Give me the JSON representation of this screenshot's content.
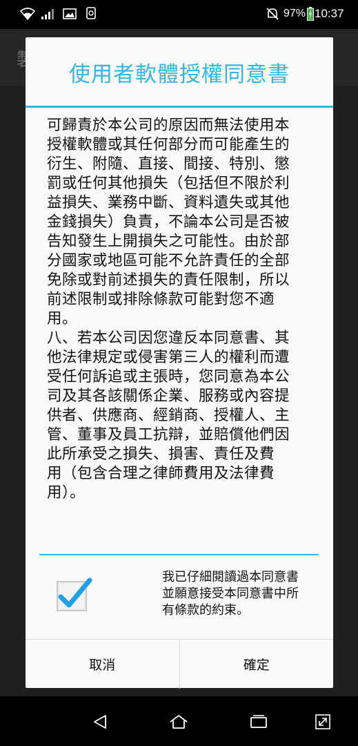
{
  "status_bar": {
    "battery_percent": "97%",
    "time": "10:37",
    "icons": [
      "wifi-icon",
      "signal-icon",
      "image-icon",
      "touch-icon",
      "mute-icon",
      "battery-charging-icon"
    ]
  },
  "background_app": {
    "title_char": "製"
  },
  "dialog": {
    "title": "使用者軟體授權同意書",
    "body": "可歸責於本公司的原因而無法使用本\n授權軟體或其任何部分而可能產生的\n衍生、附隨、直接、間接、特別、懲\n罰或任何其他損失（包括但不限於利\n益損失、業務中斷、資料遺失或其他\n金錢損失）負責，不論本公司是否被\n告知發生上開損失之可能性。由於部\n分國家或地區可能不允許責任的全部\n免除或對前述損失的責任限制，所以\n前述限制或排除條款可能對您不適\n用。\n八、若本公司因您違反本同意書、其\n他法律規定或侵害第三人的權利而遭\n受任何訴追或主張時，您同意為本公\n司及其各該關係企業、服務或內容提\n供者、供應商、經銷商、授權人、主\n管、董事及員工抗辯，並賠償他們因\n此所承受之損失、損害、責任及費\n用（包含合理之律師費用及法律費\n用）。",
    "agree_checked": true,
    "agree_label": "我已仔細閱讀過本同意書\n並願意接受本同意書中所\n有條款的約束。",
    "cancel_label": "取消",
    "confirm_label": "確定"
  },
  "nav_bar": {
    "icons": [
      "back-icon",
      "home-icon",
      "recents-icon",
      "expand-icon"
    ]
  },
  "colors": {
    "accent": "#33b5e5",
    "check": "#1ea0e6"
  }
}
